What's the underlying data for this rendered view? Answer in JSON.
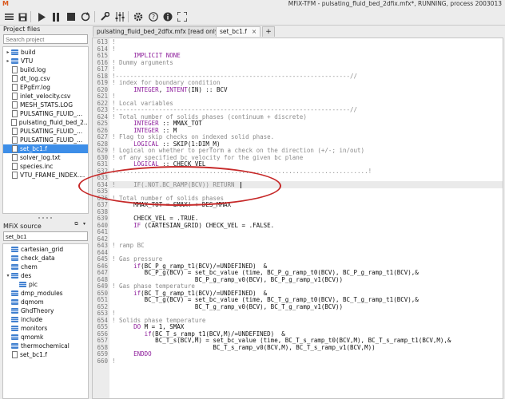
{
  "window": {
    "logo": "M",
    "title": "MFiX-TFM - pulsating_fluid_bed_2dfix.mfx*, RUNNING, process 2003013"
  },
  "toolbar": {
    "icons": [
      "hamburger-menu-icon",
      "save-icon",
      "play-icon",
      "pause-icon",
      "stop-icon",
      "reset-icon",
      "wrench-icon",
      "sliders-icon",
      "gear-icon",
      "help-icon",
      "info-icon",
      "fullscreen-icon"
    ]
  },
  "project_files": {
    "label": "Project files",
    "search_placeholder": "Search project",
    "items": [
      {
        "label": "build",
        "type": "folder",
        "expandable": true
      },
      {
        "label": "VTU",
        "type": "folder",
        "expandable": true
      },
      {
        "label": "build.log",
        "type": "file"
      },
      {
        "label": "dt_log.csv",
        "type": "file"
      },
      {
        "label": "EPgErr.log",
        "type": "file"
      },
      {
        "label": "inlet_velocity.csv",
        "type": "file"
      },
      {
        "label": "MESH_STATS.LOG",
        "type": "file"
      },
      {
        "label": "PULSATING_FLUID_...",
        "type": "file"
      },
      {
        "label": "pulsating_fluid_bed_2...",
        "type": "file"
      },
      {
        "label": "PULSATING_FLUID_...",
        "type": "file"
      },
      {
        "label": "PULSATING_FLUID_...",
        "type": "file"
      },
      {
        "label": "set_bc1.f",
        "type": "file",
        "selected": true
      },
      {
        "label": "solver_log.txt",
        "type": "file"
      },
      {
        "label": "species.inc",
        "type": "file"
      },
      {
        "label": "VTU_FRAME_INDEX....",
        "type": "file"
      }
    ]
  },
  "mfix_source": {
    "label": "MFiX source",
    "search_value": "set_bc1",
    "items": [
      {
        "label": "cartesian_grid",
        "type": "folder"
      },
      {
        "label": "check_data",
        "type": "folder"
      },
      {
        "label": "chem",
        "type": "folder"
      },
      {
        "label": "des",
        "type": "folder",
        "expanded": true
      },
      {
        "label": "pic",
        "type": "folder",
        "indent": 1
      },
      {
        "label": "dmp_modules",
        "type": "folder"
      },
      {
        "label": "dqmom",
        "type": "folder"
      },
      {
        "label": "GhdTheory",
        "type": "folder"
      },
      {
        "label": "include",
        "type": "folder"
      },
      {
        "label": "monitors",
        "type": "folder"
      },
      {
        "label": "qmomk",
        "type": "folder"
      },
      {
        "label": "thermochemical",
        "type": "folder"
      },
      {
        "label": "set_bc1.f",
        "type": "file"
      }
    ]
  },
  "tabs": [
    {
      "label": "pulsating_fluid_bed_2dfix.mfx [read only]",
      "active": false
    },
    {
      "label": "set_bc1.f",
      "active": true,
      "close": "×"
    }
  ],
  "tab_add": "+",
  "editor": {
    "highlight_line": 634,
    "lines": [
      {
        "n": "613",
        "t": "!"
      },
      {
        "n": "614",
        "t": "!"
      },
      {
        "n": "615",
        "t": "      IMPLICIT NONE"
      },
      {
        "n": "616",
        "t": "! Dummy arguments"
      },
      {
        "n": "617",
        "t": "!"
      },
      {
        "n": "618",
        "t": "!-----------------------------------------------------------------//"
      },
      {
        "n": "619",
        "t": "! index for boundary condition"
      },
      {
        "n": "620",
        "t": "      INTEGER, INTENT(IN) :: BCV"
      },
      {
        "n": "621",
        "t": "!"
      },
      {
        "n": "622",
        "t": "! Local variables"
      },
      {
        "n": "623",
        "t": "!-----------------------------------------------------------------//"
      },
      {
        "n": "624",
        "t": "! Total number of solids phases (continuum + discrete)"
      },
      {
        "n": "625",
        "t": "      INTEGER :: MMAX_TOT"
      },
      {
        "n": "626",
        "t": "      INTEGER :: M"
      },
      {
        "n": "627",
        "t": "! Flag to skip checks on indexed solid phase."
      },
      {
        "n": "628",
        "t": "      LOGICAL :: SKIP(1:DIM_M)"
      },
      {
        "n": "629",
        "t": "! Logical on whether to perform a check on the direction (+/-; in/out)"
      },
      {
        "n": "630",
        "t": "! of any specified bc velocity for the given bc plane"
      },
      {
        "n": "631",
        "t": "      LOGICAL :: CHECK_VEL"
      },
      {
        "n": "632",
        "t": "!......................................................................!"
      },
      {
        "n": "633",
        "t": ""
      },
      {
        "n": "634",
        "t": "!     IF(.NOT.BC_RAMP(BCV)) RETURN"
      },
      {
        "n": "635",
        "t": ""
      },
      {
        "n": "636",
        "t": "! Total number of solids phases"
      },
      {
        "n": "637",
        "t": "      MMAX_TOT = SMAX! + DES_MMAX"
      },
      {
        "n": "638",
        "t": ""
      },
      {
        "n": "639",
        "t": "      CHECK_VEL = .TRUE."
      },
      {
        "n": "640",
        "t": "      IF (CARTESIAN_GRID) CHECK_VEL = .FALSE."
      },
      {
        "n": "641",
        "t": ""
      },
      {
        "n": "642",
        "t": ""
      },
      {
        "n": "643",
        "t": "! ramp BC"
      },
      {
        "n": "644",
        "t": ""
      },
      {
        "n": "645",
        "t": "! Gas pressure"
      },
      {
        "n": "646",
        "t": "      if(BC_P_g_ramp_t1(BCV)/=UNDEFINED)  &"
      },
      {
        "n": "647",
        "t": "         BC_P_g(BCV) = set_bc_value (time, BC_P_g_ramp_t0(BCV), BC_P_g_ramp_t1(BCV),&"
      },
      {
        "n": "648",
        "t": "                       BC_P_g_ramp_v0(BCV), BC_P_g_ramp_v1(BCV))"
      },
      {
        "n": "649",
        "t": "! Gas phase temperature"
      },
      {
        "n": "650",
        "t": "      if(BC_T_g_ramp_t1(BCV)/=UNDEFINED)  &"
      },
      {
        "n": "651",
        "t": "         BC_T_g(BCV) = set_bc_value (time, BC_T_g_ramp_t0(BCV), BC_T_g_ramp_t1(BCV),&"
      },
      {
        "n": "652",
        "t": "                       BC_T_g_ramp_v0(BCV), BC_T_g_ramp_v1(BCV))"
      },
      {
        "n": "653",
        "t": "!"
      },
      {
        "n": "654",
        "t": "! Solids phase temperature"
      },
      {
        "n": "655",
        "t": "      DO M = 1, SMAX"
      },
      {
        "n": "656",
        "t": "         if(BC_T_s_ramp_t1(BCV,M)/=UNDEFINED)  &"
      },
      {
        "n": "657",
        "t": "            BC_T_s(BCV,M) = set_bc_value (time, BC_T_s_ramp_t0(BCV,M), BC_T_s_ramp_t1(BCV,M),&"
      },
      {
        "n": "658",
        "t": "                            BC_T_s_ramp_v0(BCV,M), BC_T_s_ramp_v1(BCV,M))"
      },
      {
        "n": "659",
        "t": "      ENDDO"
      },
      {
        "n": "660",
        "t": "!"
      }
    ]
  },
  "annotation_color": "#c62828"
}
